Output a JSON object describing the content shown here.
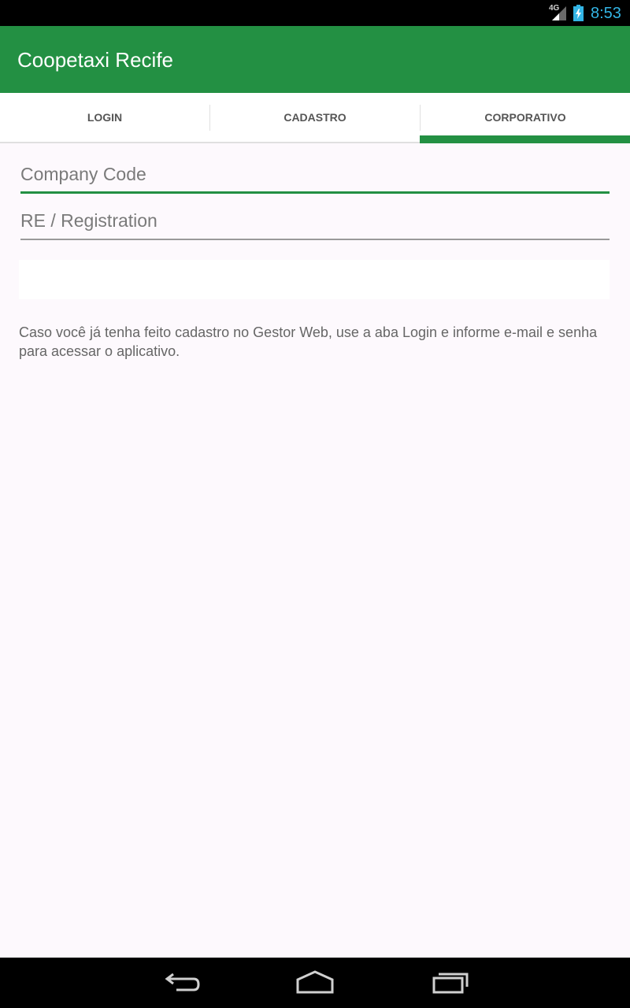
{
  "status_bar": {
    "network_label": "4G",
    "time": "8:53",
    "icons": [
      "signal-icon",
      "battery-charging-icon"
    ]
  },
  "app_bar": {
    "title": "Coopetaxi Recife"
  },
  "tabs": [
    {
      "label": "LOGIN",
      "selected": false
    },
    {
      "label": "CADASTRO",
      "selected": false
    },
    {
      "label": "CORPORATIVO",
      "selected": true
    }
  ],
  "form": {
    "company_code_placeholder": "Company Code",
    "registration_placeholder": "RE / Registration"
  },
  "info_text": "Caso você já tenha feito cadastro no Gestor Web, use a aba Login e informe e-mail e senha para acessar o aplicativo.",
  "nav_bar": {
    "icons": [
      "back-icon",
      "home-icon",
      "recents-icon"
    ]
  },
  "colors": {
    "accent": "#239043",
    "status_text": "#33b5e5"
  }
}
